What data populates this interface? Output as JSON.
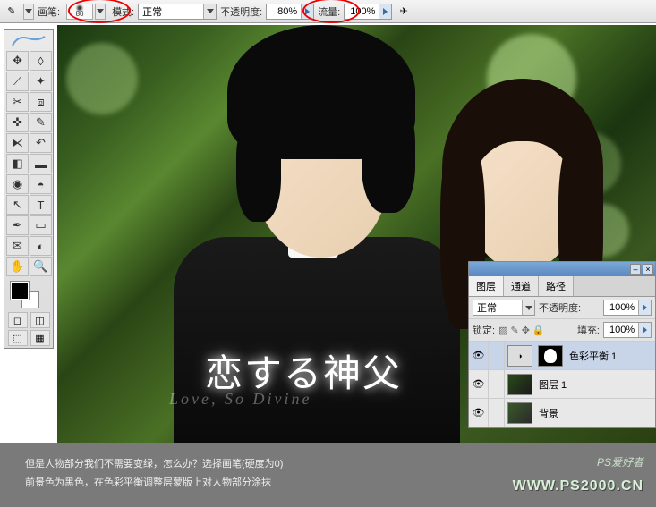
{
  "topbar": {
    "brush_label": "画笔:",
    "brush_size": "80",
    "mode_label": "模式:",
    "mode_value": "正常",
    "opacity_label": "不透明度:",
    "opacity_value": "80%",
    "flow_label": "流量:",
    "flow_value": "100%"
  },
  "tools": {
    "items": [
      {
        "name": "move-tool",
        "glyph": "✥"
      },
      {
        "name": "marquee-tool",
        "glyph": "◊"
      },
      {
        "name": "lasso-tool",
        "glyph": "⟋"
      },
      {
        "name": "wand-tool",
        "glyph": "✦"
      },
      {
        "name": "crop-tool",
        "glyph": "✂"
      },
      {
        "name": "slice-tool",
        "glyph": "⧈"
      },
      {
        "name": "heal-tool",
        "glyph": "✜"
      },
      {
        "name": "brush-tool",
        "glyph": "✎"
      },
      {
        "name": "stamp-tool",
        "glyph": "⧔"
      },
      {
        "name": "history-tool",
        "glyph": "↶"
      },
      {
        "name": "eraser-tool",
        "glyph": "◧"
      },
      {
        "name": "gradient-tool",
        "glyph": "▬"
      },
      {
        "name": "blur-tool",
        "glyph": "◉"
      },
      {
        "name": "dodge-tool",
        "glyph": "◓"
      },
      {
        "name": "path-tool",
        "glyph": "↖"
      },
      {
        "name": "type-tool",
        "glyph": "T"
      },
      {
        "name": "pen-tool",
        "glyph": "✒"
      },
      {
        "name": "shape-tool",
        "glyph": "▭"
      },
      {
        "name": "notes-tool",
        "glyph": "✉"
      },
      {
        "name": "eyedrop-tool",
        "glyph": "◐"
      },
      {
        "name": "hand-tool",
        "glyph": "✋"
      },
      {
        "name": "zoom-tool",
        "glyph": "🔍"
      }
    ]
  },
  "canvas": {
    "title_jp": "恋する神父",
    "subtitle_en": "Love, So Divine"
  },
  "layers_panel": {
    "tab_layers": "图层",
    "tab_channels": "通道",
    "tab_paths": "路径",
    "blend_value": "正常",
    "opacity_label": "不透明度:",
    "opacity_value": "100%",
    "lock_label": "锁定:",
    "fill_label": "填充:",
    "fill_value": "100%",
    "layers": [
      {
        "name": "色彩平衡 1",
        "type": "adjustment",
        "selected": true
      },
      {
        "name": "图层 1",
        "type": "image",
        "selected": false
      },
      {
        "name": "背景",
        "type": "bg",
        "selected": false
      }
    ]
  },
  "caption": {
    "line1": "但是人物部分我们不需要变绿，怎么办？选择画笔(硬度为0)",
    "line2": "前景色为黑色，在色彩平衡调整层蒙版上对人物部分涂抹"
  },
  "watermark": {
    "line1": "PS爱好者",
    "line2": "WWW.PS2000.CN"
  }
}
